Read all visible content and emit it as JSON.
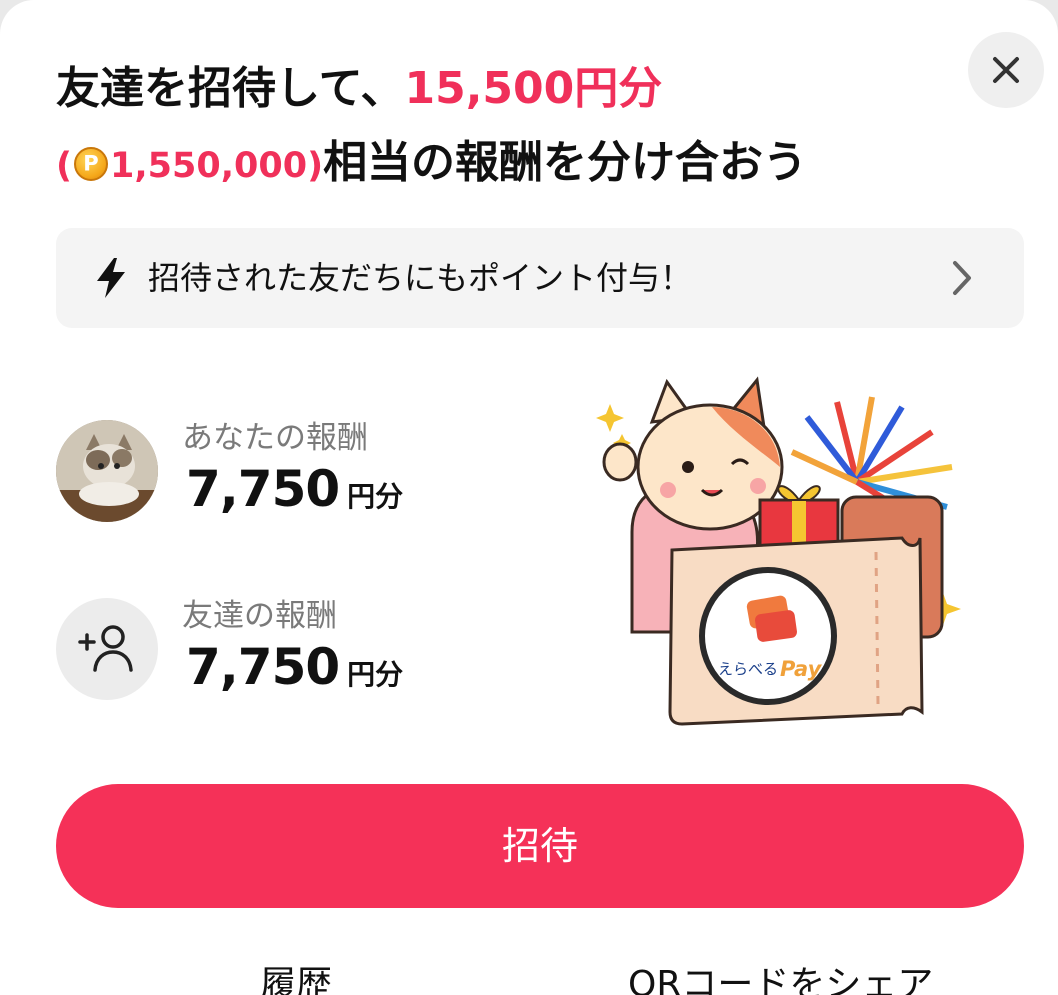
{
  "header": {
    "title_line1_prefix": "友達を招待して、",
    "title_line1_amount": "15,500円分",
    "title_line2_paren_open": "(",
    "coin_symbol": "P",
    "title_line2_points": "1,550,000)",
    "title_line2_suffix": "相当の報酬を分け合おう",
    "close_icon": "close-icon"
  },
  "notice": {
    "icon": "lightning-icon",
    "text": "招待された友だちにもポイント付与！",
    "chevron_icon": "chevron-right-icon"
  },
  "rewards": {
    "mine": {
      "label": "あなたの報酬",
      "amount": "7,750",
      "unit": "円分"
    },
    "friend": {
      "label": "友達の報酬",
      "amount": "7,750",
      "unit": "円分"
    }
  },
  "illustration": {
    "pay_brand_kana": "えらべる",
    "pay_brand_word": "Pay"
  },
  "actions": {
    "invite_label": "招待",
    "history_label": "履歴",
    "qr_share_label": "QRコードをシェア"
  },
  "colors": {
    "accent": "#f0305a",
    "invite_button": "#f53158",
    "notice_bg": "#f4f4f4"
  }
}
